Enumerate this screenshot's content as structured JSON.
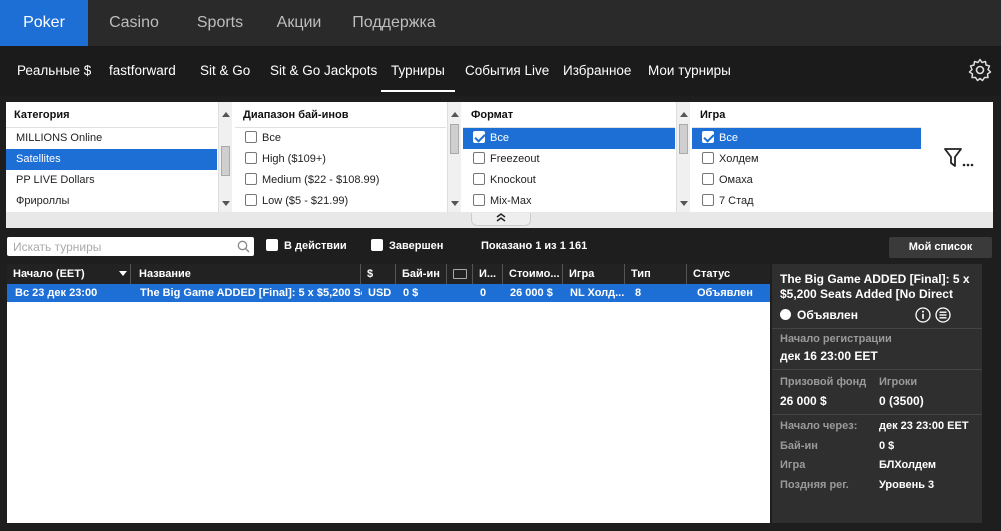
{
  "top_tabs": [
    "Poker",
    "Casino",
    "Sports",
    "Акции",
    "Поддержка"
  ],
  "sub_tabs": [
    "Реальные $",
    "fastforward",
    "Sit & Go",
    "Sit & Go Jackpots",
    "Турниры",
    "События Live",
    "Избранное",
    "Мои турниры"
  ],
  "filters": {
    "category": {
      "header": "Категория",
      "options": [
        "MILLIONS Online",
        "Satellites",
        "PP LIVE Dollars",
        "Фрироллы"
      ]
    },
    "buyin": {
      "header": "Диапазон бай-инов",
      "options": [
        "Все",
        "High ($109+)",
        "Medium ($22 - $108.99)",
        "Low ($5 - $21.99)"
      ]
    },
    "format": {
      "header": "Формат",
      "options": [
        "Все",
        "Freezeout",
        "Knockout",
        "Mix-Max"
      ]
    },
    "game": {
      "header": "Игра",
      "options": [
        "Все",
        "Холдем",
        "Омаха",
        "7 Стад"
      ]
    }
  },
  "search": {
    "placeholder": "Искать турниры"
  },
  "checks": {
    "in_play": "В действии",
    "completed": "Завершен"
  },
  "shown_text": "Показано 1 из 1 161",
  "mylist_label": "Мой список",
  "table": {
    "headers": [
      "Начало (EET)",
      "Название",
      "$",
      "Бай-ин",
      "",
      "И...",
      "Стоимо...",
      "Игра",
      "Тип",
      "Статус"
    ],
    "rows": [
      [
        "Вс 23 дек 23:00",
        "The Big Game ADDED [Final]: 5 x $5,200 Se...",
        "USD",
        "0 $",
        "",
        "0",
        "26 000 $",
        "NL Холд...",
        "8",
        "Объявлен"
      ]
    ]
  },
  "details": {
    "title": "The Big Game ADDED [Final]: 5 x $5,200 Seats Added [No Direct",
    "status": "Объявлен",
    "reg_start_label": "Начало регистрации",
    "reg_start_value": "дек 16 23:00 EET",
    "prize_label": "Призовой фонд",
    "prize_value": "26 000 $",
    "players_label": "Игроки",
    "players_value": "0 (3500)",
    "start_in_label": "Начало через:",
    "start_in_value": "дек 23 23:00 EET",
    "buyin_label": "Бай-ин",
    "buyin_value": "0 $",
    "game_label": "Игра",
    "game_value": "БЛХолдем",
    "late_reg_label": "Поздняя рег.",
    "late_reg_value": "Уровень 3"
  }
}
